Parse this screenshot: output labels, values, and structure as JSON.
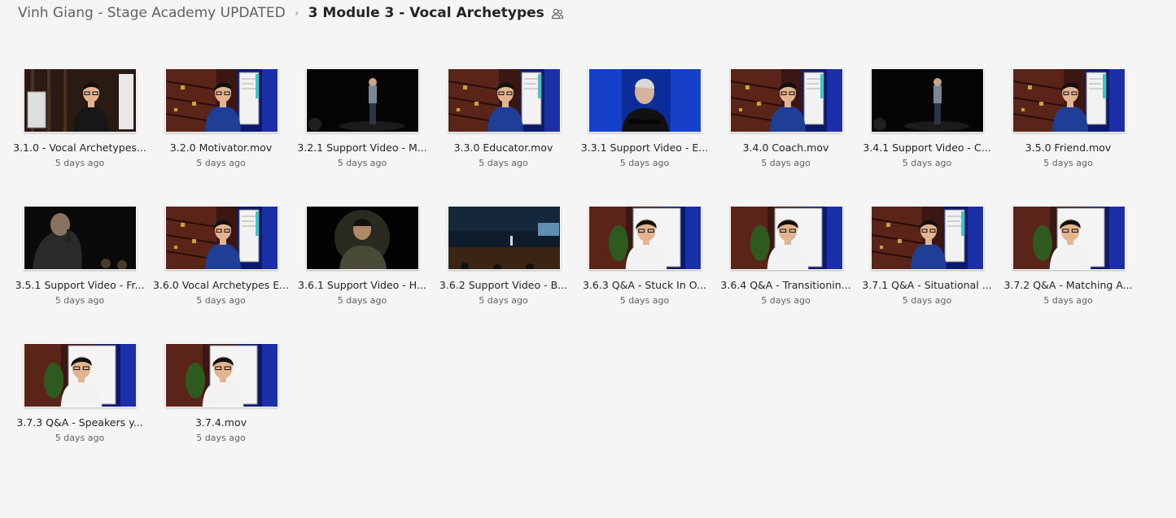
{
  "breadcrumb": {
    "root": "Vinh Giang - Stage Academy UPDATED",
    "separator": "›",
    "current": "3 Module 3 - Vocal Archetypes",
    "shared_icon": "people-icon"
  },
  "files": [
    {
      "name": "3.1.0 - Vocal Archetypes...",
      "modified": "5 days ago",
      "thumb": "wood-stage-left"
    },
    {
      "name": "3.2.0 Motivator.mov",
      "modified": "5 days ago",
      "thumb": "studio-whiteboard"
    },
    {
      "name": "3.2.1 Support Video - M...",
      "modified": "5 days ago",
      "thumb": "dark-stage-speaker"
    },
    {
      "name": "3.3.0 Educator.mov",
      "modified": "5 days ago",
      "thumb": "studio-whiteboard"
    },
    {
      "name": "3.3.1 Support Video - E...",
      "modified": "5 days ago",
      "thumb": "blue-stage-speaker"
    },
    {
      "name": "3.4.0 Coach.mov",
      "modified": "5 days ago",
      "thumb": "studio-whiteboard"
    },
    {
      "name": "3.4.1 Support Video - C...",
      "modified": "5 days ago",
      "thumb": "dark-stage-speaker"
    },
    {
      "name": "3.5.0 Friend.mov",
      "modified": "5 days ago",
      "thumb": "studio-whiteboard"
    },
    {
      "name": "3.5.1 Support Video - Fr...",
      "modified": "5 days ago",
      "thumb": "dark-stage-mic"
    },
    {
      "name": "3.6.0 Vocal Archetypes E...",
      "modified": "5 days ago",
      "thumb": "studio-whiteboard"
    },
    {
      "name": "3.6.1 Support Video - H...",
      "modified": "5 days ago",
      "thumb": "spotlight-circle"
    },
    {
      "name": "3.6.2 Support Video - B...",
      "modified": "5 days ago",
      "thumb": "wide-stage"
    },
    {
      "name": "3.6.3 Q&A - Stuck In O...",
      "modified": "5 days ago",
      "thumb": "studio-qa"
    },
    {
      "name": "3.6.4 Q&A - Transitionin...",
      "modified": "5 days ago",
      "thumb": "studio-qa"
    },
    {
      "name": "3.7.1 Q&A - Situational ...",
      "modified": "5 days ago",
      "thumb": "studio-whiteboard"
    },
    {
      "name": "3.7.2 Q&A - Matching A...",
      "modified": "5 days ago",
      "thumb": "studio-qa"
    },
    {
      "name": "3.7.3 Q&A - Speakers y...",
      "modified": "5 days ago",
      "thumb": "studio-qa"
    },
    {
      "name": "3.7.4.mov",
      "modified": "5 days ago",
      "thumb": "studio-qa"
    }
  ]
}
